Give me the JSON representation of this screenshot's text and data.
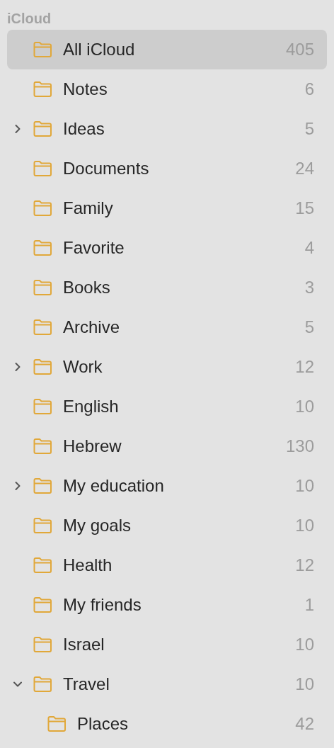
{
  "section": {
    "title": "iCloud"
  },
  "folders": [
    {
      "name": "All iCloud",
      "count": "405",
      "selected": true
    },
    {
      "name": "Notes",
      "count": "6",
      "selected": false
    },
    {
      "name": "Ideas",
      "count": "5",
      "selected": false,
      "expanded": false
    },
    {
      "name": "Documents",
      "count": "24",
      "selected": false
    },
    {
      "name": "Family",
      "count": "15",
      "selected": false
    },
    {
      "name": "Favorite",
      "count": "4",
      "selected": false
    },
    {
      "name": "Books",
      "count": "3",
      "selected": false
    },
    {
      "name": "Archive",
      "count": "5",
      "selected": false
    },
    {
      "name": "Work",
      "count": "12",
      "selected": false,
      "expanded": false
    },
    {
      "name": "English",
      "count": "10",
      "selected": false
    },
    {
      "name": "Hebrew",
      "count": "130",
      "selected": false
    },
    {
      "name": "My education",
      "count": "10",
      "selected": false,
      "expanded": false
    },
    {
      "name": "My goals",
      "count": "10",
      "selected": false
    },
    {
      "name": "Health",
      "count": "12",
      "selected": false
    },
    {
      "name": "My friends",
      "count": "1",
      "selected": false
    },
    {
      "name": "Israel",
      "count": "10",
      "selected": false
    },
    {
      "name": "Travel",
      "count": "10",
      "selected": false,
      "expanded": true,
      "children": [
        {
          "name": "Places",
          "count": "42",
          "selected": false
        }
      ]
    }
  ]
}
